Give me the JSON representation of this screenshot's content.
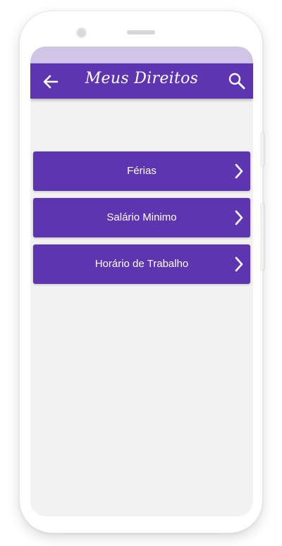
{
  "app_bar": {
    "title": "Meus Direitos",
    "back_icon": "arrow-back-icon",
    "search_icon": "search-icon",
    "color": "#5e35b1"
  },
  "status_bar": {
    "color": "#d1c5e5"
  },
  "menu": {
    "items": [
      {
        "label": "Férias",
        "icon": "chevron-right-icon"
      },
      {
        "label": "Salário Minimo",
        "icon": "chevron-right-icon"
      },
      {
        "label": "Horário de Trabalho",
        "icon": "chevron-right-icon"
      }
    ]
  }
}
